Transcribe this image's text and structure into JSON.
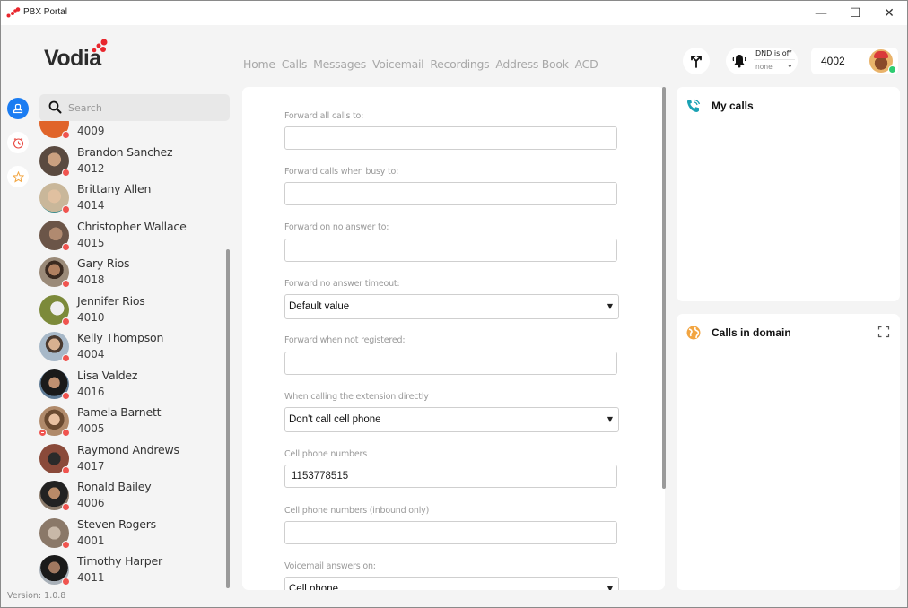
{
  "window": {
    "title": "PBX Portal",
    "controls": {
      "minimize": "—",
      "maximize": "☐",
      "close": "✕"
    }
  },
  "logo": {
    "text": "Vodia",
    "accent": "#e8262d"
  },
  "nav": {
    "items": [
      {
        "label": "Home"
      },
      {
        "label": "Calls"
      },
      {
        "label": "Messages"
      },
      {
        "label": "Voicemail"
      },
      {
        "label": "Recordings"
      },
      {
        "label": "Address Book"
      },
      {
        "label": "ACD"
      }
    ]
  },
  "header": {
    "dnd_status": "DND is off",
    "dnd_mode": "none",
    "extension": "4002",
    "presence_color": "#2ecc71"
  },
  "rail": {
    "items": [
      {
        "name": "contacts",
        "icon": "person-icon",
        "active": true
      },
      {
        "name": "history",
        "icon": "clock-icon",
        "active": false
      },
      {
        "name": "favorites",
        "icon": "star-icon",
        "active": false
      }
    ],
    "accent": "#1a7cf2"
  },
  "search": {
    "placeholder": "Search",
    "value": ""
  },
  "contacts": [
    {
      "name": "",
      "ext": "4009",
      "color": "#e0642a"
    },
    {
      "name": "Brandon Sanchez",
      "ext": "4012",
      "color": "#5a4a40"
    },
    {
      "name": "Brittany Allen",
      "ext": "4014",
      "color": "#c9b79a"
    },
    {
      "name": "Christopher Wallace",
      "ext": "4015",
      "color": "#6b5548"
    },
    {
      "name": "Gary Rios",
      "ext": "4018",
      "color": "#9a8a78"
    },
    {
      "name": "Jennifer Rios",
      "ext": "4010",
      "color": "#7c8a3a"
    },
    {
      "name": "Kelly Thompson",
      "ext": "4004",
      "color": "#a7917a"
    },
    {
      "name": "Lisa Valdez",
      "ext": "4016",
      "color": "#5e7a94"
    },
    {
      "name": "Pamela Barnett",
      "ext": "4005",
      "color": "#b08a6a",
      "dnd": true
    },
    {
      "name": "Raymond Andrews",
      "ext": "4017",
      "color": "#6a4a3a"
    },
    {
      "name": "Ronald Bailey",
      "ext": "4006",
      "color": "#5a4c3c"
    },
    {
      "name": "Steven Rogers",
      "ext": "4001",
      "color": "#8a7868"
    },
    {
      "name": "Timothy Harper",
      "ext": "4011",
      "color": "#4a5a6a"
    }
  ],
  "presence_offline_color": "#f0544f",
  "version": "Version: 1.0.8",
  "form": {
    "fields": [
      {
        "label": "Forward all calls to:",
        "type": "text",
        "value": ""
      },
      {
        "label": "Forward calls when busy to:",
        "type": "text",
        "value": ""
      },
      {
        "label": "Forward on no answer to:",
        "type": "text",
        "value": ""
      },
      {
        "label": "Forward no answer timeout:",
        "type": "select",
        "value": "Default value"
      },
      {
        "label": "Forward when not registered:",
        "type": "text",
        "value": ""
      },
      {
        "label": "When calling the extension directly",
        "type": "select",
        "value": "Don't call cell phone"
      },
      {
        "label": "Cell phone numbers",
        "type": "text",
        "value": "1153778515"
      },
      {
        "label": "Cell phone numbers (inbound only)",
        "type": "text",
        "value": ""
      },
      {
        "label": "Voicemail answers on:",
        "type": "select",
        "value": "Cell phone"
      }
    ]
  },
  "cards": {
    "my_calls": {
      "title": "My calls",
      "icon_color": "#1aa1b3"
    },
    "calls_in_domain": {
      "title": "Calls in domain",
      "icon_color": "#f2a541"
    }
  }
}
